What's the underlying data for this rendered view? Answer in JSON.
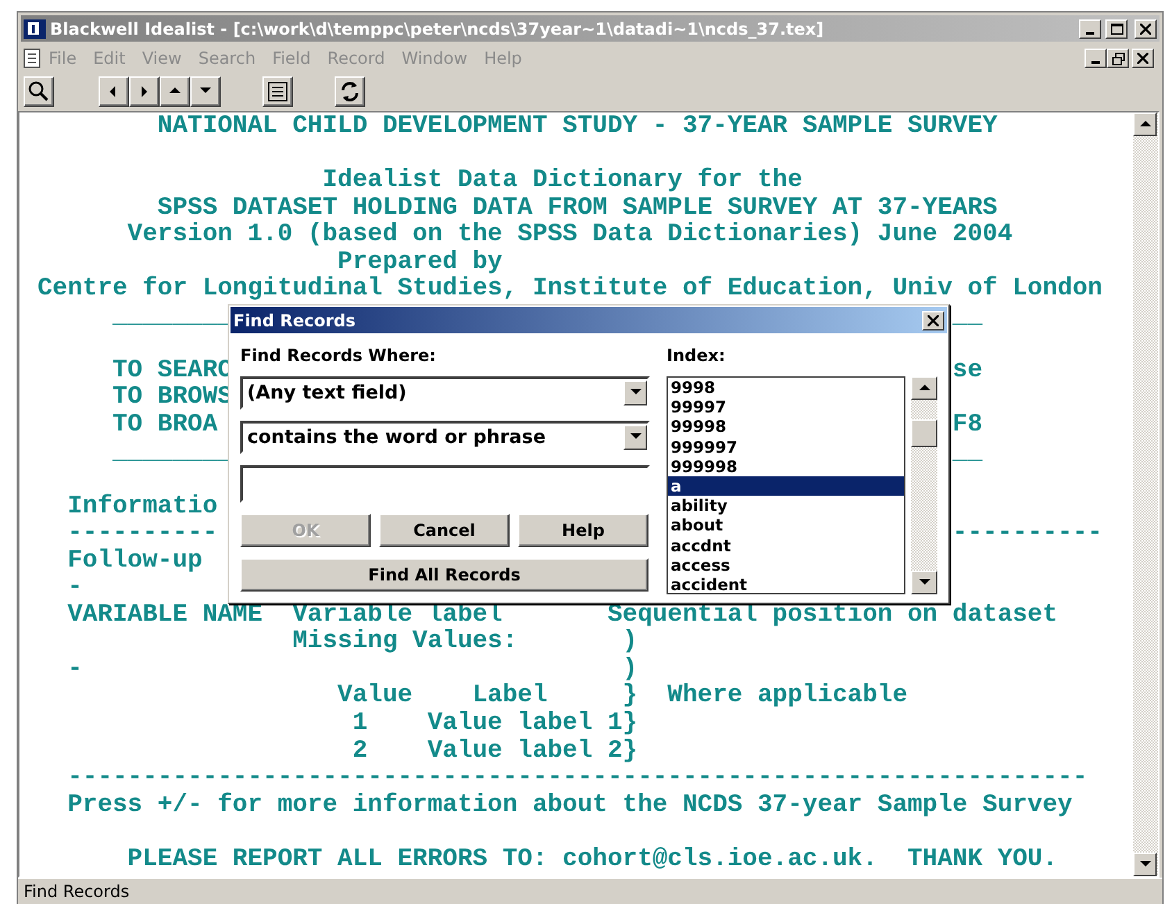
{
  "window": {
    "title": "Blackwell Idealist - [c:\\work\\d\\temppc\\peter\\ncds\\37year~1\\datadi~1\\ncds_37.tex]"
  },
  "menu": [
    {
      "label": "File",
      "disabled": true
    },
    {
      "label": "Edit",
      "disabled": true
    },
    {
      "label": "View",
      "disabled": true
    },
    {
      "label": "Search",
      "disabled": true
    },
    {
      "label": "Field",
      "disabled": true
    },
    {
      "label": "Record",
      "disabled": true
    },
    {
      "label": "Window",
      "disabled": true
    },
    {
      "label": "Help",
      "disabled": true
    }
  ],
  "document": {
    "lines": [
      {
        "kind": "text",
        "text": "        NATIONAL CHILD DEVELOPMENT STUDY - 37-YEAR SAMPLE SURVEY"
      },
      {
        "kind": "blank"
      },
      {
        "kind": "text",
        "text": "                   Idealist Data Dictionary for the"
      },
      {
        "kind": "text",
        "text": "        SPSS DATASET HOLDING DATA FROM SAMPLE SURVEY AT 37-YEARS"
      },
      {
        "kind": "text",
        "text": "      Version 1.0 (based on the SPSS Data Dictionaries) June 2004"
      },
      {
        "kind": "text",
        "text": "                    Prepared by"
      },
      {
        "kind": "text",
        "text": "Centre for Longitudinal Studies, Institute of Education, Univ of London"
      },
      {
        "kind": "split",
        "left": "     ________",
        "right": "__"
      },
      {
        "kind": "blank"
      },
      {
        "kind": "split",
        "left": "     TO SEARC",
        "right": "se"
      },
      {
        "kind": "split",
        "left": "     TO BROWS"
      },
      {
        "kind": "split",
        "left": "     TO BROA",
        "right": "F8"
      },
      {
        "kind": "split",
        "left": "     ________",
        "right": "__"
      },
      {
        "kind": "blank"
      },
      {
        "kind": "split",
        "left": "  Informatio"
      },
      {
        "kind": "split",
        "left": "  ----------",
        "right": "----------"
      },
      {
        "kind": "split",
        "left": "  Follow-up"
      },
      {
        "kind": "split",
        "left": "  -"
      },
      {
        "kind": "text",
        "text": "  VARIABLE NAME  Variable label       Sequential position on dataset"
      },
      {
        "kind": "text",
        "text": "                 Missing Values:       )"
      },
      {
        "kind": "text",
        "text": "  -                                    )"
      },
      {
        "kind": "text",
        "text": "                    Value    Label     }  Where applicable"
      },
      {
        "kind": "text",
        "text": "                     1    Value label 1}"
      },
      {
        "kind": "text",
        "text": "                     2    Value label 2}"
      },
      {
        "kind": "text",
        "text": "  --------------------------------------------------------------------"
      },
      {
        "kind": "text",
        "text": "  Press +/- for more information about the NCDS 37-year Sample Survey"
      },
      {
        "kind": "blank"
      },
      {
        "kind": "text",
        "text": "      PLEASE REPORT ALL ERRORS TO: cohort@cls.ioe.ac.uk.  THANK YOU."
      }
    ]
  },
  "dialog": {
    "title": "Find Records",
    "where_label": "Find Records Where:",
    "field_select": "(Any text field)",
    "condition_select": "contains the word or phrase",
    "buttons": [
      {
        "label": "OK",
        "disabled": true
      },
      {
        "label": "Cancel",
        "disabled": false
      },
      {
        "label": "Help",
        "disabled": false
      }
    ],
    "find_all_button": "Find All Records",
    "index_label": "Index:",
    "index_items": [
      {
        "label": "9998",
        "selected": false
      },
      {
        "label": "99997",
        "selected": false
      },
      {
        "label": "99998",
        "selected": false
      },
      {
        "label": "999997",
        "selected": false
      },
      {
        "label": "999998",
        "selected": false
      },
      {
        "label": "a",
        "selected": true
      },
      {
        "label": "ability",
        "selected": false
      },
      {
        "label": "about",
        "selected": false
      },
      {
        "label": "accdnt",
        "selected": false
      },
      {
        "label": "access",
        "selected": false
      },
      {
        "label": "accident",
        "selected": false
      }
    ]
  },
  "status_bar": "Find Records"
}
